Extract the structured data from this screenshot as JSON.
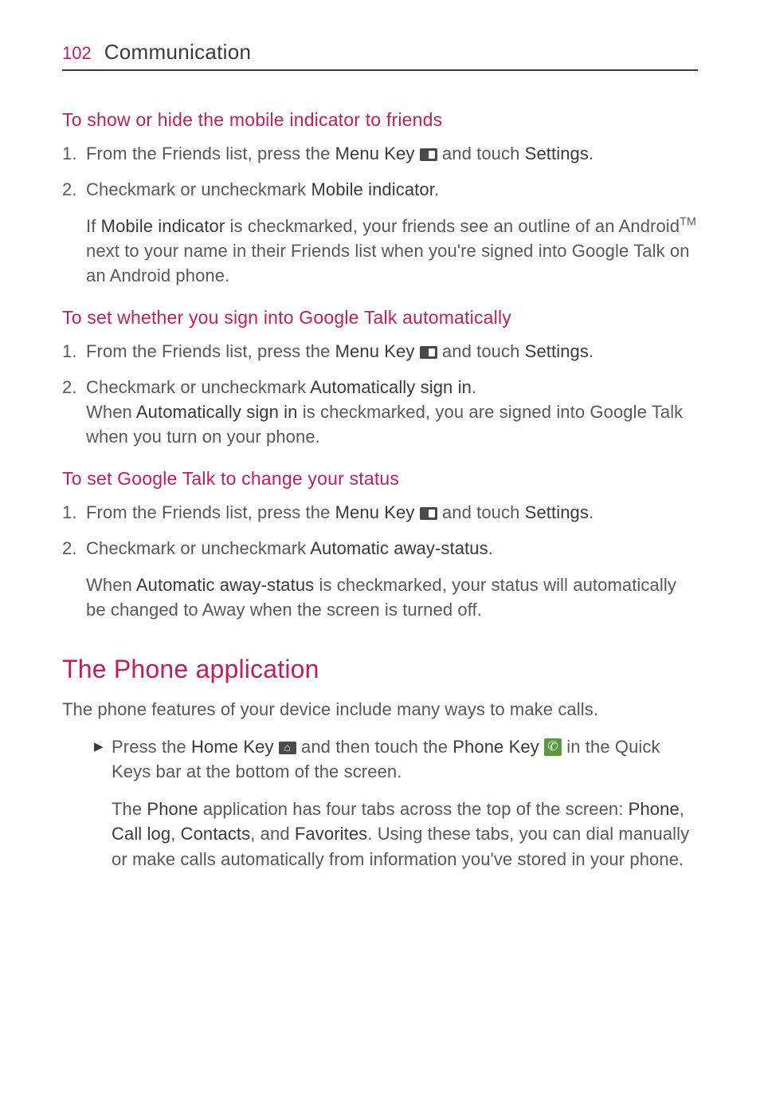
{
  "header": {
    "pageNumber": "102",
    "sectionTitle": "Communication"
  },
  "sec1": {
    "title": "To show or hide the mobile indicator to friends",
    "step1_a": "From the Friends list, press the ",
    "step1_b": "Menu Key",
    "step1_c": " and touch ",
    "step1_d": "Settings",
    "step1_e": ".",
    "step2_a": "Checkmark or uncheckmark ",
    "step2_b": "Mobile indicator",
    "step2_c": ".",
    "para_a": "If ",
    "para_b": "Mobile indicator",
    "para_c": " is checkmarked, your friends see an outline of an Android",
    "para_tm": "TM",
    "para_d": " next to your name in their Friends list when you're signed into Google Talk on an Android phone."
  },
  "sec2": {
    "title": "To set whether you sign into Google Talk automatically",
    "step1_a": "From the Friends list, press the ",
    "step1_b": "Menu Key",
    "step1_c": " and touch ",
    "step1_d": "Settings",
    "step1_e": ".",
    "step2_a": "Checkmark or uncheckmark ",
    "step2_b": "Automatically sign in",
    "step2_c": ".",
    "step2_d": "When ",
    "step2_e": "Automatically sign in",
    "step2_f": " is checkmarked, you are signed into Google Talk when you turn on your phone."
  },
  "sec3": {
    "title": "To set Google Talk to change your status",
    "step1_a": "From the Friends list, press the ",
    "step1_b": "Menu Key",
    "step1_c": " and touch ",
    "step1_d": "Settings",
    "step1_e": ".",
    "step2_a": "Checkmark or uncheckmark ",
    "step2_b": "Automatic away-status",
    "step2_c": ".",
    "para_a": "When ",
    "para_b": "Automatic away-status",
    "para_c": " is checkmarked, your status will automatically be changed to Away when the screen is turned off."
  },
  "main": {
    "heading": "The Phone application",
    "intro": "The phone features of your device include many ways to make calls.",
    "bullet1_a": "Press the ",
    "bullet1_b": "Home Key",
    "bullet1_c": " and then touch the ",
    "bullet1_d": "Phone Key",
    "bullet1_e": " in the Quick Keys bar at the bottom of the screen.",
    "bullet2_a": "The ",
    "bullet2_b": "Phone",
    "bullet2_c": " application has four tabs across the top of the screen: ",
    "bullet2_d": "Phone",
    "bullet2_e": ", ",
    "bullet2_f": "Call log",
    "bullet2_g": ", ",
    "bullet2_h": "Contacts",
    "bullet2_i": ", and ",
    "bullet2_j": "Favorites",
    "bullet2_k": ". Using these tabs, you can dial manually or make calls automatically from information you've stored in your phone."
  },
  "nums": {
    "one": "1.",
    "two": "2."
  }
}
